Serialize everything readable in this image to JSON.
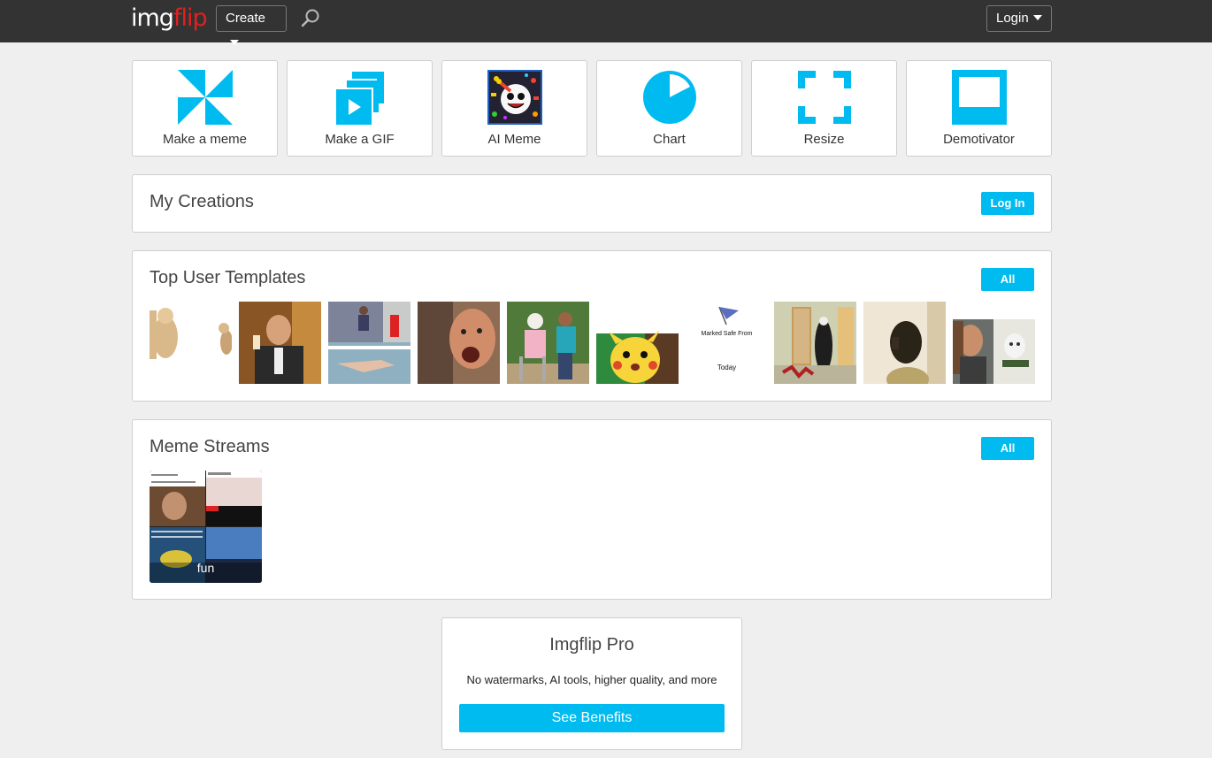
{
  "header": {
    "logo_part1": "img",
    "logo_part2": "flip",
    "create_label": "Create",
    "login_label": "Login",
    "search_icon": "search-icon"
  },
  "tools": [
    {
      "label": "Make a meme",
      "icon": "pinwheel-icon"
    },
    {
      "label": "Make a GIF",
      "icon": "gif-stack-icon"
    },
    {
      "label": "AI Meme",
      "icon": "ai-meme-icon"
    },
    {
      "label": "Chart",
      "icon": "pie-chart-icon"
    },
    {
      "label": "Resize",
      "icon": "resize-icon"
    },
    {
      "label": "Demotivator",
      "icon": "demotivator-frame-icon"
    }
  ],
  "my_creations": {
    "title": "My Creations",
    "login_button": "Log In"
  },
  "top_templates": {
    "title": "Top User Templates",
    "all_button": "All",
    "marked_safe_top": "Marked Safe From",
    "marked_safe_bottom": "Today"
  },
  "meme_streams": {
    "title": "Meme Streams",
    "all_button": "All",
    "stream_label": "fun"
  },
  "pro": {
    "title": "Imgflip Pro",
    "subtitle": "No watermarks, AI tools, higher quality, and more",
    "button": "See Benefits"
  },
  "colors": {
    "accent": "#00bbf0",
    "topbar": "#333333",
    "logo_red": "#e02020"
  }
}
